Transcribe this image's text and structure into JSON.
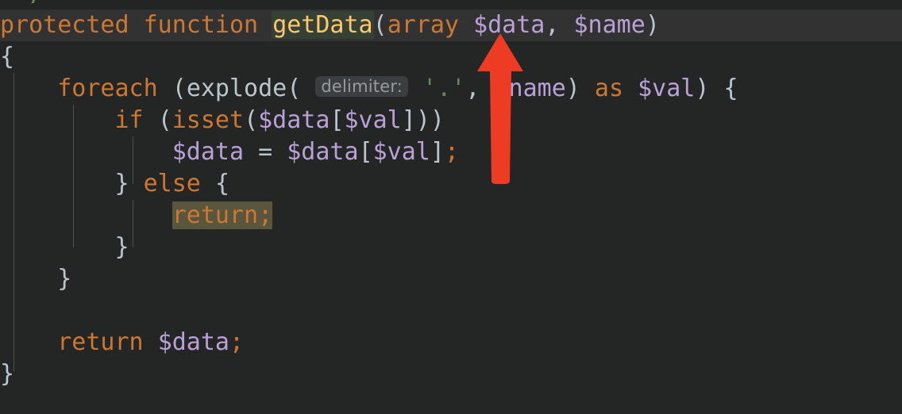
{
  "app": {
    "kind": "code-editor",
    "language": "PHP",
    "theme": "dark"
  },
  "colors": {
    "editor_background": "#242525",
    "gutter_background": "#232424",
    "current_line_background": "#323232",
    "keyword": "#cc7832",
    "function_name": "#ffc66d",
    "variable": "#b9a1d8",
    "punctuation": "#bcc4cc",
    "string": "#6a8759",
    "comment": "#6a9955",
    "declaration_highlight": "#344134",
    "usage_highlight": "#5a553d",
    "hint_background": "#3b3e40",
    "hint_text": "#9a9a9a",
    "indent_guide": "#4b4f52",
    "annotation_arrow": "#ee3b24"
  },
  "partial_line_above": {
    "text": "/"
  },
  "code": {
    "line1": {
      "indent": "",
      "kw_protected": "protected",
      "kw_function": "function",
      "name": "getData",
      "paren_open": "(",
      "kw_array": "array",
      "param1": "$data",
      "comma": ",",
      "param2": "$name",
      "paren_close": ")"
    },
    "line2": {
      "brace": "{"
    },
    "line3": {
      "indent": "    ",
      "kw_foreach": "foreach",
      "paren_open": "(",
      "fn_explode": "explode",
      "paren_open2": "(",
      "hint": "delimiter:",
      "string": "'.'",
      "comma": ",",
      "arg": "$name",
      "paren_close2": ")",
      "kw_as": "as",
      "var_val": "$val",
      "paren_close": ")",
      "brace": "{"
    },
    "line4": {
      "indent": "        ",
      "kw_if": "if",
      "paren_open": "(",
      "fn_isset": "isset",
      "paren_open2": "(",
      "var_data": "$data",
      "bracket_open": "[",
      "var_val": "$val",
      "bracket_close": "]",
      "paren_close2": ")",
      "paren_close": ")"
    },
    "line5": {
      "indent": "            ",
      "lhs": "$data",
      "equals": "=",
      "rhs": "$data",
      "bracket_open": "[",
      "index": "$val",
      "bracket_close": "]",
      "semicolon": ";"
    },
    "line6": {
      "indent": "        ",
      "brace_close": "}",
      "kw_else": "else",
      "brace_open": "{"
    },
    "line7": {
      "indent": "            ",
      "statement": "return;"
    },
    "line8": {
      "indent": "        ",
      "brace_close": "}"
    },
    "line9": {
      "indent": "    ",
      "brace_close": "}"
    },
    "line10": {
      "text": ""
    },
    "line11": {
      "indent": "    ",
      "kw_return": "return",
      "var_data": "$data",
      "semicolon": ";"
    },
    "line12": {
      "brace_close": "}"
    }
  },
  "annotation": {
    "arrow_label": "red-up-arrow",
    "points_to": "$data",
    "color": "#ee3b24"
  }
}
